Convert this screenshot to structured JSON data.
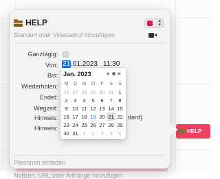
{
  "event": {
    "title": "HELP",
    "color": "#e4164b",
    "location_placeholder": "Standort oder Videoanruf hinzufügen"
  },
  "fields": {
    "all_day_label": "Ganztägig:",
    "from_label": "Von:",
    "from_date_day": "21",
    "from_date_rest": ".01.2023",
    "from_time": "11:30",
    "to_label": "Bis:",
    "repeat_label": "Wiederholen:",
    "ends_label": "Endet:",
    "travel_label": "Wegzeit:",
    "alert_label": "Hinweis:",
    "alert_value_partial": "dard)",
    "alert2_label": "Hinweis:"
  },
  "calendar": {
    "month": "Jan. 2023",
    "nav_prev": "◀",
    "nav_next": "▶",
    "weekdays": [
      "M",
      "D",
      "M",
      "D",
      "F",
      "S",
      "S"
    ],
    "weeks": [
      [
        {
          "d": "26",
          "m": true
        },
        {
          "d": "27",
          "m": true
        },
        {
          "d": "28",
          "m": true
        },
        {
          "d": "29",
          "m": true
        },
        {
          "d": "30",
          "m": true
        },
        {
          "d": "31",
          "m": true
        },
        {
          "d": "1"
        }
      ],
      [
        {
          "d": "2"
        },
        {
          "d": "3"
        },
        {
          "d": "4"
        },
        {
          "d": "5"
        },
        {
          "d": "6"
        },
        {
          "d": "7"
        },
        {
          "d": "8"
        }
      ],
      [
        {
          "d": "9"
        },
        {
          "d": "10"
        },
        {
          "d": "11"
        },
        {
          "d": "12"
        },
        {
          "d": "13"
        },
        {
          "d": "14"
        },
        {
          "d": "15"
        }
      ],
      [
        {
          "d": "16"
        },
        {
          "d": "17"
        },
        {
          "d": "18"
        },
        {
          "d": "19",
          "today": true
        },
        {
          "d": "20"
        },
        {
          "d": "21",
          "selected": true
        },
        {
          "d": "22"
        }
      ],
      [
        {
          "d": "23"
        },
        {
          "d": "24"
        },
        {
          "d": "25"
        },
        {
          "d": "26"
        },
        {
          "d": "27"
        },
        {
          "d": "28"
        },
        {
          "d": "29"
        }
      ],
      [
        {
          "d": "30"
        },
        {
          "d": "31"
        },
        {
          "d": "1",
          "m": true
        },
        {
          "d": "2",
          "m": true
        },
        {
          "d": "3",
          "m": true
        },
        {
          "d": "4",
          "m": true
        },
        {
          "d": "5",
          "m": true
        }
      ]
    ]
  },
  "invite_placeholder": "Personen einladen",
  "notes_placeholder": "Notizen, URL oder Anhänge hinzufügen",
  "background_event": {
    "title": "HELP",
    "color": "#f0405e"
  },
  "icons": {
    "title": "folder-icon",
    "video": "video-camera-icon",
    "color_stepper": "chevron-up-down-icon"
  }
}
